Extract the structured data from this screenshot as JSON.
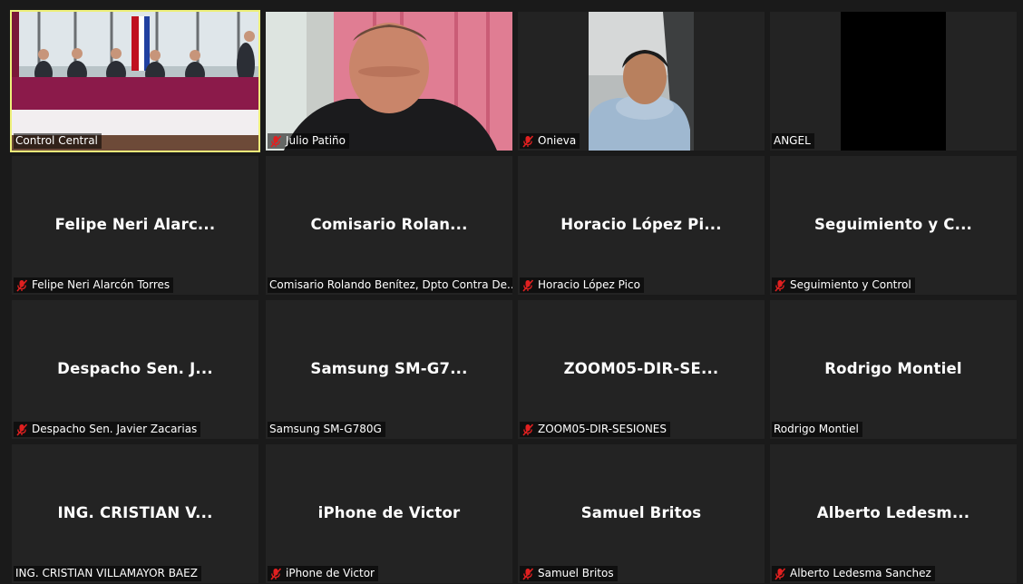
{
  "participants": [
    {
      "label": "Control Central",
      "muted": false,
      "video": "conference-room",
      "active": true
    },
    {
      "label": "Julio Patiño",
      "muted": true,
      "video": "man-pink-curtain"
    },
    {
      "label": "Onieva",
      "muted": true,
      "video": "man-in-car"
    },
    {
      "label": "ANGEL",
      "muted": false,
      "video": "black-screen"
    },
    {
      "display": "Felipe Neri Alarc...",
      "label": "Felipe Neri Alarcón Torres",
      "muted": true
    },
    {
      "display": "Comisario Rolan...",
      "label": "Comisario Rolando Benítez, Dpto Contra De...",
      "muted": false
    },
    {
      "display": "Horacio López Pi...",
      "label": "Horacio López Pico",
      "muted": true
    },
    {
      "display": "Seguimiento y C...",
      "label": "Seguimiento y Control",
      "muted": true
    },
    {
      "display": "Despacho Sen. J...",
      "label": "Despacho Sen. Javier Zacarias",
      "muted": true
    },
    {
      "display": "Samsung SM-G7...",
      "label": "Samsung SM-G780G",
      "muted": false
    },
    {
      "display": "ZOOM05-DIR-SE...",
      "label": "ZOOM05-DIR-SESIONES",
      "muted": true
    },
    {
      "display": "Rodrigo Montiel",
      "label": "Rodrigo Montiel",
      "muted": false
    },
    {
      "display": "ING. CRISTIAN V...",
      "label": "ING. CRISTIAN VILLAMAYOR BAEZ",
      "muted": false
    },
    {
      "display": "iPhone de Victor",
      "label": "iPhone de Victor",
      "muted": true
    },
    {
      "display": "Samuel Britos",
      "label": "Samuel Britos",
      "muted": true
    },
    {
      "display": "Alberto Ledesm...",
      "label": "Alberto Ledesma Sanchez",
      "muted": true
    }
  ],
  "colors": {
    "mute_red": "#e02020",
    "active_border": "#eef07a",
    "tile_bg": "#232323"
  }
}
